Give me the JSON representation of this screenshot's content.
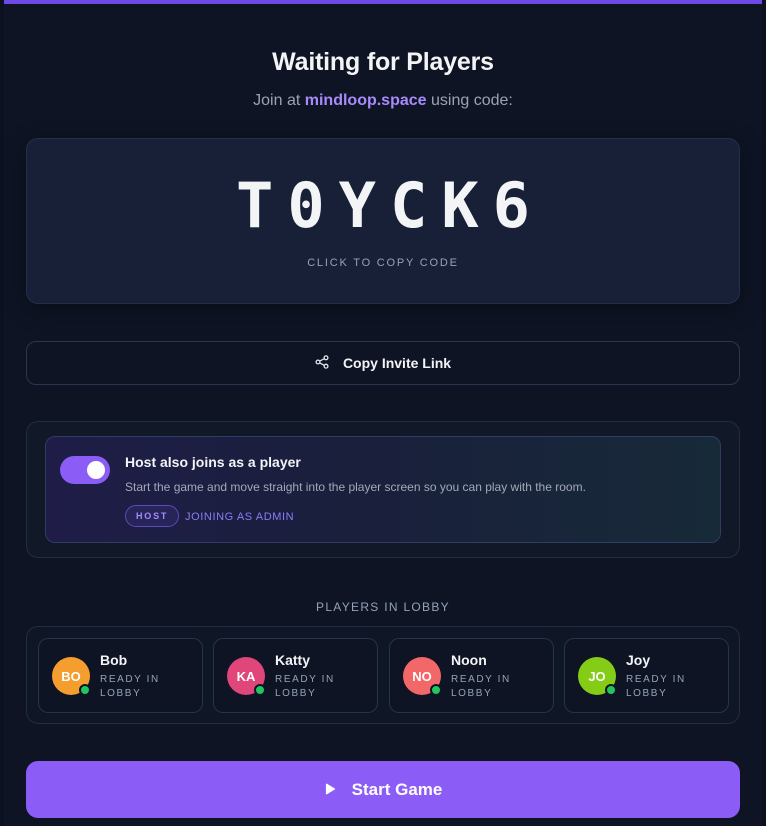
{
  "header": {
    "title": "Waiting for Players",
    "subtitle_prefix": "Join at",
    "domain": "mindloop.space",
    "subtitle_suffix": "using code:"
  },
  "code_card": {
    "code": "T0YCK6",
    "hint": "CLICK TO COPY CODE"
  },
  "invite": {
    "label": "Copy Invite Link",
    "icon": "share-icon"
  },
  "host_option": {
    "toggle_on": true,
    "title": "Host also joins as a player",
    "description": "Start the game and move straight into the player screen so you can play with the room.",
    "badge": "HOST",
    "status": "JOINING AS ADMIN"
  },
  "lobby": {
    "heading": "PLAYERS IN LOBBY",
    "players": [
      {
        "initials": "BO",
        "name": "Bob",
        "status": "READY IN LOBBY",
        "color": "#f59e2f"
      },
      {
        "initials": "KA",
        "name": "Katty",
        "status": "READY IN LOBBY",
        "color": "#e0467a"
      },
      {
        "initials": "NO",
        "name": "Noon",
        "status": "READY IN LOBBY",
        "color": "#f26868"
      },
      {
        "initials": "JO",
        "name": "Joy",
        "status": "READY IN LOBBY",
        "color": "#84cc16"
      }
    ]
  },
  "start": {
    "label": "Start Game",
    "icon": "play-icon"
  },
  "colors": {
    "accent": "#8b5cf6",
    "background": "#0e1424",
    "online": "#22c55e"
  }
}
